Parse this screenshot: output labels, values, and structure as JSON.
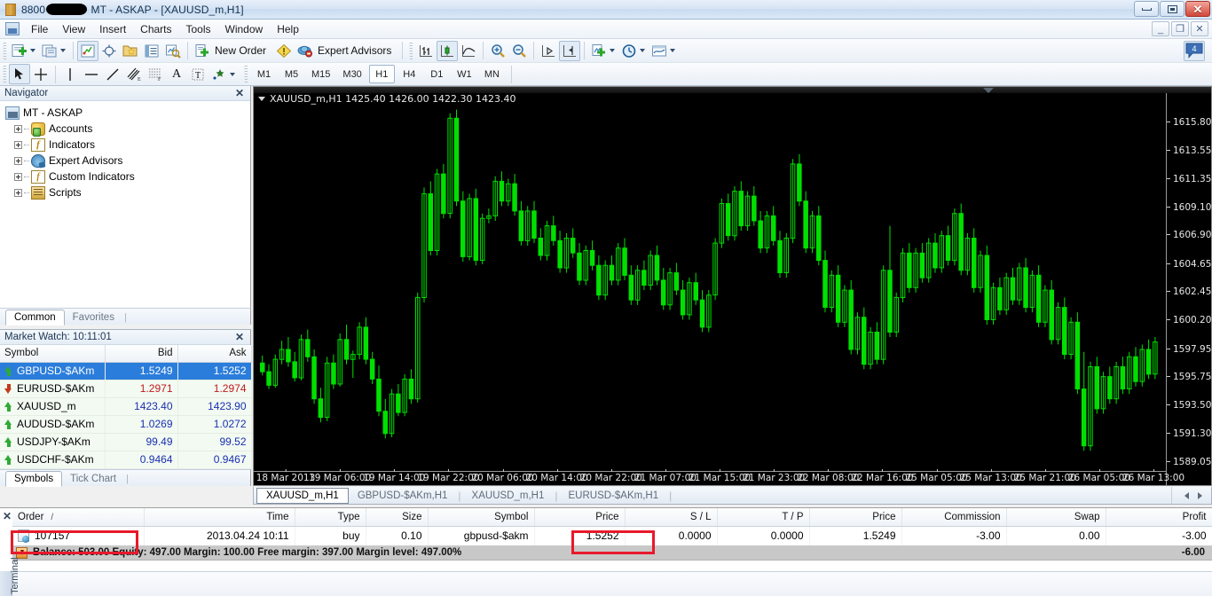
{
  "window": {
    "title_prefix": "8800",
    "title_suffix": " MT - ASKAP - [XAUUSD_m,H1]",
    "minimize": "_",
    "maximize": "□",
    "close": "✕",
    "mdi_minimize": "_",
    "mdi_restore": "❐",
    "mdi_close": "✕"
  },
  "menu": {
    "items": [
      {
        "label": "File"
      },
      {
        "label": "View"
      },
      {
        "label": "Insert"
      },
      {
        "label": "Charts"
      },
      {
        "label": "Tools"
      },
      {
        "label": "Window"
      },
      {
        "label": "Help"
      }
    ]
  },
  "toolbar": {
    "new_order_label": "New Order",
    "expert_advisors_label": "Expert Advisors",
    "badge_count": "4",
    "buttons": [
      {
        "name": "new-chart-icon"
      },
      {
        "name": "profiles-icon"
      },
      {
        "name": "market-watch-icon"
      },
      {
        "name": "data-window-icon"
      },
      {
        "name": "navigator-icon"
      },
      {
        "name": "terminal-icon"
      },
      {
        "name": "strategy-tester-icon"
      },
      {
        "name": "new-order-icon"
      },
      {
        "name": "alert-icon"
      },
      {
        "name": "expert-advisors-icon"
      },
      {
        "name": "bar-chart-icon"
      },
      {
        "name": "candlestick-chart-icon"
      },
      {
        "name": "line-chart-icon"
      },
      {
        "name": "zoom-in-icon"
      },
      {
        "name": "zoom-out-icon"
      },
      {
        "name": "auto-scroll-icon"
      },
      {
        "name": "chart-shift-icon"
      },
      {
        "name": "indicators-icon"
      },
      {
        "name": "periods-icon"
      },
      {
        "name": "templates-icon"
      }
    ]
  },
  "linestudies": {
    "tools": [
      {
        "name": "cursor-icon"
      },
      {
        "name": "crosshair-icon"
      },
      {
        "name": "vertical-line-icon"
      },
      {
        "name": "horizontal-line-icon"
      },
      {
        "name": "trendline-icon"
      },
      {
        "name": "equidistant-channel-icon"
      },
      {
        "name": "fibonacci-retracement-icon"
      },
      {
        "name": "text-icon"
      },
      {
        "name": "text-label-icon"
      },
      {
        "name": "shapes-icon"
      }
    ],
    "periods": [
      "M1",
      "M5",
      "M15",
      "M30",
      "H1",
      "H4",
      "D1",
      "W1",
      "MN"
    ],
    "active_period": "H1"
  },
  "navigator": {
    "title": "Navigator",
    "close": "✕",
    "root": "MT - ASKAP",
    "items": [
      {
        "label": "Accounts",
        "icon": "accounts-icon"
      },
      {
        "label": "Indicators",
        "icon": "indicators-icon"
      },
      {
        "label": "Expert Advisors",
        "icon": "expert-advisors-icon"
      },
      {
        "label": "Custom Indicators",
        "icon": "custom-indicators-icon"
      },
      {
        "label": "Scripts",
        "icon": "scripts-icon"
      }
    ],
    "tabs": [
      {
        "label": "Common",
        "active": true
      },
      {
        "label": "Favorites",
        "active": false
      }
    ]
  },
  "market_watch": {
    "title": "Market Watch: 10:11:01",
    "close": "✕",
    "columns": [
      "Symbol",
      "Bid",
      "Ask"
    ],
    "rows": [
      {
        "symbol": "GBPUSD-$AKm",
        "bid": "1.5249",
        "ask": "1.5252",
        "dir": "up",
        "selected": true
      },
      {
        "symbol": "EURUSD-$AKm",
        "bid": "1.2971",
        "ask": "1.2974",
        "dir": "down",
        "selected": false
      },
      {
        "symbol": "XAUUSD_m",
        "bid": "1423.40",
        "ask": "1423.90",
        "dir": "up",
        "selected": false
      },
      {
        "symbol": "AUDUSD-$AKm",
        "bid": "1.0269",
        "ask": "1.0272",
        "dir": "up",
        "selected": false
      },
      {
        "symbol": "USDJPY-$AKm",
        "bid": "99.49",
        "ask": "99.52",
        "dir": "up",
        "selected": false
      },
      {
        "symbol": "USDCHF-$AKm",
        "bid": "0.9464",
        "ask": "0.9467",
        "dir": "up",
        "selected": false
      }
    ],
    "tabs": [
      {
        "label": "Symbols",
        "active": true
      },
      {
        "label": "Tick Chart",
        "active": false
      }
    ]
  },
  "chart": {
    "label": "XAUUSD_m,H1  1425.40 1426.00 1422.30 1423.40",
    "tabs": [
      {
        "label": "XAUUSD_m,H1",
        "active": true
      },
      {
        "label": "GBPUSD-$AKm,H1",
        "active": false
      },
      {
        "label": "XAUUSD_m,H1",
        "active": false
      },
      {
        "label": "EURUSD-$AKm,H1",
        "active": false
      }
    ]
  },
  "chart_data": {
    "type": "candlestick",
    "title": "XAUUSD_m,H1",
    "symbol": "XAUUSD_m",
    "timeframe": "H1",
    "ohlc_header": {
      "open": "1425.40",
      "high": "1426.00",
      "low": "1422.30",
      "close": "1423.40"
    },
    "bg_color": "#000000",
    "bull_color": "#00e000",
    "bear_color": "#00e000",
    "grid": false,
    "ylabel": "",
    "xlabel": "",
    "ylim": [
      1588.0,
      1617.2
    ],
    "y_ticks": [
      "1615.80",
      "1613.55",
      "1611.35",
      "1609.10",
      "1606.90",
      "1604.65",
      "1602.45",
      "1600.20",
      "1597.95",
      "1595.75",
      "1593.50",
      "1591.30",
      "1589.05"
    ],
    "x_ticks": [
      "18 Mar 2013",
      "19 Mar 06:00",
      "19 Mar 14:00",
      "19 Mar 22:00",
      "20 Mar 06:00",
      "20 Mar 14:00",
      "20 Mar 22:00",
      "21 Mar 07:00",
      "21 Mar 15:00",
      "21 Mar 23:00",
      "22 Mar 08:00",
      "22 Mar 16:00",
      "25 Mar 05:00",
      "25 Mar 13:00",
      "25 Mar 21:00",
      "26 Mar 05:00",
      "26 Mar 13:00"
    ],
    "candles": [
      [
        1596.3,
        1596.9,
        1595.3,
        1595.6
      ],
      [
        1595.6,
        1596.2,
        1594.2,
        1594.5
      ],
      [
        1594.5,
        1597.0,
        1594.3,
        1596.6
      ],
      [
        1596.6,
        1598.1,
        1596.2,
        1597.4
      ],
      [
        1597.4,
        1598.4,
        1596.0,
        1596.4
      ],
      [
        1596.4,
        1597.2,
        1594.8,
        1595.1
      ],
      [
        1595.1,
        1598.6,
        1594.9,
        1598.2
      ],
      [
        1598.2,
        1599.0,
        1596.4,
        1596.8
      ],
      [
        1596.8,
        1597.4,
        1593.0,
        1593.4
      ],
      [
        1593.4,
        1594.3,
        1591.5,
        1591.9
      ],
      [
        1591.9,
        1596.8,
        1591.6,
        1596.3
      ],
      [
        1596.3,
        1597.0,
        1594.2,
        1594.6
      ],
      [
        1594.6,
        1598.7,
        1594.4,
        1598.2
      ],
      [
        1598.2,
        1599.4,
        1596.2,
        1596.6
      ],
      [
        1596.6,
        1597.3,
        1595.1,
        1597.0
      ],
      [
        1597.0,
        1599.6,
        1596.6,
        1599.2
      ],
      [
        1599.2,
        1600.0,
        1596.2,
        1596.6
      ],
      [
        1596.6,
        1597.2,
        1594.6,
        1595.0
      ],
      [
        1595.0,
        1596.1,
        1592.0,
        1592.4
      ],
      [
        1592.4,
        1593.4,
        1590.2,
        1590.6
      ],
      [
        1590.6,
        1594.2,
        1590.3,
        1593.8
      ],
      [
        1593.8,
        1594.6,
        1592.0,
        1592.3
      ],
      [
        1592.3,
        1595.4,
        1592.0,
        1595.0
      ],
      [
        1595.0,
        1595.8,
        1593.0,
        1593.4
      ],
      [
        1593.4,
        1602.0,
        1593.1,
        1601.6
      ],
      [
        1601.6,
        1610.5,
        1601.2,
        1610.0
      ],
      [
        1610.0,
        1611.0,
        1605.0,
        1605.4
      ],
      [
        1605.4,
        1612.0,
        1605.0,
        1611.6
      ],
      [
        1611.6,
        1612.4,
        1608.0,
        1608.4
      ],
      [
        1608.4,
        1616.5,
        1608.0,
        1616.1
      ],
      [
        1616.1,
        1616.8,
        1609.0,
        1609.4
      ],
      [
        1609.4,
        1610.2,
        1604.5,
        1604.9
      ],
      [
        1604.9,
        1610.0,
        1604.6,
        1609.6
      ],
      [
        1609.6,
        1610.4,
        1604.2,
        1604.6
      ],
      [
        1604.6,
        1608.4,
        1604.3,
        1608.0
      ],
      [
        1608.0,
        1608.8,
        1607.6,
        1608.2
      ],
      [
        1608.2,
        1611.4,
        1607.8,
        1611.0
      ],
      [
        1611.0,
        1611.8,
        1609.0,
        1609.4
      ],
      [
        1609.4,
        1611.2,
        1609.0,
        1610.8
      ],
      [
        1610.8,
        1611.6,
        1608.2,
        1608.6
      ],
      [
        1608.6,
        1609.4,
        1605.8,
        1606.2
      ],
      [
        1606.2,
        1609.0,
        1605.8,
        1608.6
      ],
      [
        1608.6,
        1609.4,
        1606.0,
        1606.4
      ],
      [
        1606.4,
        1607.2,
        1604.6,
        1605.0
      ],
      [
        1605.0,
        1607.8,
        1604.6,
        1607.4
      ],
      [
        1607.4,
        1608.2,
        1605.8,
        1606.2
      ],
      [
        1606.2,
        1607.0,
        1603.6,
        1604.0
      ],
      [
        1604.0,
        1606.8,
        1603.6,
        1606.4
      ],
      [
        1606.4,
        1607.2,
        1604.8,
        1605.2
      ],
      [
        1605.2,
        1606.0,
        1602.6,
        1603.0
      ],
      [
        1603.0,
        1605.8,
        1602.6,
        1605.4
      ],
      [
        1605.4,
        1606.2,
        1603.8,
        1604.2
      ],
      [
        1604.2,
        1605.0,
        1601.4,
        1601.8
      ],
      [
        1601.8,
        1604.6,
        1601.4,
        1604.2
      ],
      [
        1604.2,
        1605.0,
        1602.6,
        1603.0
      ],
      [
        1603.0,
        1606.0,
        1602.6,
        1605.6
      ],
      [
        1605.6,
        1606.4,
        1603.0,
        1603.4
      ],
      [
        1603.4,
        1604.2,
        1601.0,
        1601.4
      ],
      [
        1601.4,
        1604.2,
        1601.0,
        1603.8
      ],
      [
        1603.8,
        1604.6,
        1602.2,
        1602.6
      ],
      [
        1602.6,
        1605.4,
        1602.2,
        1605.0
      ],
      [
        1605.0,
        1605.8,
        1602.6,
        1603.0
      ],
      [
        1603.0,
        1604.0,
        1600.6,
        1601.0
      ],
      [
        1601.0,
        1604.0,
        1600.6,
        1603.6
      ],
      [
        1603.6,
        1604.4,
        1601.8,
        1602.2
      ],
      [
        1602.2,
        1603.0,
        1599.8,
        1600.2
      ],
      [
        1600.2,
        1603.2,
        1599.8,
        1602.8
      ],
      [
        1602.8,
        1603.6,
        1601.0,
        1601.4
      ],
      [
        1601.4,
        1602.2,
        1598.8,
        1599.2
      ],
      [
        1599.2,
        1602.2,
        1598.8,
        1601.8
      ],
      [
        1601.8,
        1606.4,
        1601.4,
        1606.0
      ],
      [
        1606.0,
        1609.6,
        1605.6,
        1609.2
      ],
      [
        1609.2,
        1610.0,
        1606.2,
        1606.6
      ],
      [
        1606.6,
        1610.6,
        1606.2,
        1610.2
      ],
      [
        1610.2,
        1611.0,
        1607.0,
        1607.4
      ],
      [
        1607.4,
        1610.2,
        1607.0,
        1609.8
      ],
      [
        1609.8,
        1610.6,
        1607.4,
        1607.8
      ],
      [
        1607.8,
        1608.6,
        1605.2,
        1605.6
      ],
      [
        1605.6,
        1608.6,
        1605.2,
        1608.2
      ],
      [
        1608.2,
        1609.0,
        1605.8,
        1606.2
      ],
      [
        1606.2,
        1607.0,
        1603.2,
        1603.6
      ],
      [
        1603.6,
        1606.8,
        1603.2,
        1606.4
      ],
      [
        1606.4,
        1612.8,
        1606.0,
        1612.4
      ],
      [
        1612.4,
        1613.2,
        1609.0,
        1609.4
      ],
      [
        1609.4,
        1610.2,
        1605.2,
        1605.6
      ],
      [
        1605.6,
        1608.6,
        1605.2,
        1608.2
      ],
      [
        1608.2,
        1609.0,
        1604.2,
        1604.6
      ],
      [
        1604.6,
        1605.4,
        1600.4,
        1600.8
      ],
      [
        1600.8,
        1603.8,
        1600.4,
        1603.4
      ],
      [
        1603.4,
        1604.2,
        1599.2,
        1599.6
      ],
      [
        1599.6,
        1602.6,
        1599.2,
        1602.2
      ],
      [
        1602.2,
        1603.0,
        1597.0,
        1597.4
      ],
      [
        1597.4,
        1600.4,
        1597.0,
        1600.0
      ],
      [
        1600.0,
        1600.8,
        1595.8,
        1596.2
      ],
      [
        1596.2,
        1599.2,
        1595.8,
        1598.8
      ],
      [
        1598.8,
        1599.6,
        1596.2,
        1596.6
      ],
      [
        1596.6,
        1604.2,
        1596.2,
        1603.8
      ],
      [
        1603.8,
        1607.4,
        1598.4,
        1598.8
      ],
      [
        1598.8,
        1602.0,
        1598.4,
        1601.6
      ],
      [
        1601.6,
        1605.6,
        1601.2,
        1605.2
      ],
      [
        1605.2,
        1606.0,
        1602.0,
        1602.4
      ],
      [
        1602.4,
        1605.6,
        1602.0,
        1605.2
      ],
      [
        1605.2,
        1606.0,
        1602.8,
        1603.2
      ],
      [
        1603.2,
        1606.4,
        1602.8,
        1606.0
      ],
      [
        1606.0,
        1606.8,
        1603.6,
        1604.0
      ],
      [
        1604.0,
        1607.0,
        1603.6,
        1606.6
      ],
      [
        1606.6,
        1607.4,
        1604.2,
        1604.6
      ],
      [
        1604.6,
        1608.8,
        1604.2,
        1608.4
      ],
      [
        1608.4,
        1609.2,
        1603.4,
        1603.8
      ],
      [
        1603.8,
        1606.8,
        1603.4,
        1606.4
      ],
      [
        1606.4,
        1607.2,
        1602.0,
        1602.4
      ],
      [
        1602.4,
        1605.4,
        1602.0,
        1605.0
      ],
      [
        1605.0,
        1605.8,
        1599.4,
        1599.8
      ],
      [
        1599.8,
        1602.8,
        1599.4,
        1602.4
      ],
      [
        1602.4,
        1603.2,
        1600.2,
        1600.6
      ],
      [
        1600.6,
        1603.6,
        1600.2,
        1603.2
      ],
      [
        1603.2,
        1604.0,
        1601.0,
        1601.4
      ],
      [
        1601.4,
        1604.4,
        1601.0,
        1604.0
      ],
      [
        1604.0,
        1604.8,
        1600.4,
        1600.8
      ],
      [
        1600.8,
        1603.8,
        1600.4,
        1603.4
      ],
      [
        1603.4,
        1604.2,
        1599.2,
        1599.6
      ],
      [
        1599.6,
        1602.6,
        1599.2,
        1602.2
      ],
      [
        1602.2,
        1603.0,
        1597.8,
        1598.2
      ],
      [
        1598.2,
        1601.2,
        1597.8,
        1600.8
      ],
      [
        1600.8,
        1601.6,
        1596.6,
        1597.0
      ],
      [
        1597.0,
        1600.0,
        1596.6,
        1599.6
      ],
      [
        1599.6,
        1600.4,
        1593.8,
        1594.2
      ],
      [
        1594.2,
        1597.2,
        1589.2,
        1589.6
      ],
      [
        1589.6,
        1596.4,
        1589.2,
        1596.0
      ],
      [
        1596.0,
        1596.8,
        1592.2,
        1592.6
      ],
      [
        1592.6,
        1595.6,
        1592.2,
        1595.2
      ],
      [
        1595.2,
        1596.0,
        1593.0,
        1593.4
      ],
      [
        1593.4,
        1596.4,
        1593.0,
        1596.0
      ],
      [
        1596.0,
        1596.8,
        1593.8,
        1594.2
      ],
      [
        1594.2,
        1597.2,
        1593.8,
        1596.8
      ],
      [
        1596.8,
        1597.6,
        1594.4,
        1594.8
      ],
      [
        1594.8,
        1597.8,
        1594.4,
        1597.4
      ],
      [
        1597.4,
        1598.2,
        1595.0,
        1595.4
      ],
      [
        1595.4,
        1598.4,
        1595.0,
        1598.0
      ]
    ]
  },
  "terminal": {
    "close": "✕",
    "columns": [
      "Order",
      "Time",
      "Type",
      "Size",
      "Symbol",
      "Price",
      "S / L",
      "T / P",
      "Price",
      "Commission",
      "Swap",
      "Profit"
    ],
    "sort_indicator": "/",
    "rows": [
      {
        "order": "107157",
        "time": "2013.04.24 10:11",
        "type": "buy",
        "size": "0.10",
        "symbol": "gbpusd-$akm",
        "price_open": "1.5252",
        "sl": "0.0000",
        "tp": "0.0000",
        "price_cur": "1.5249",
        "commission": "-3.00",
        "swap": "0.00",
        "profit": "-3.00"
      }
    ],
    "summary": "Balance: 503.00  Equity: 497.00  Margin: 100.00  Free margin: 397.00  Margin level: 497.00%",
    "summary_total": "-6.00",
    "vertical_tab": "Terminal"
  },
  "annotations": {
    "accent_color": "#e8192c",
    "boxes": [
      {
        "name": "order-id-highlight"
      },
      {
        "name": "open-price-highlight"
      }
    ]
  }
}
